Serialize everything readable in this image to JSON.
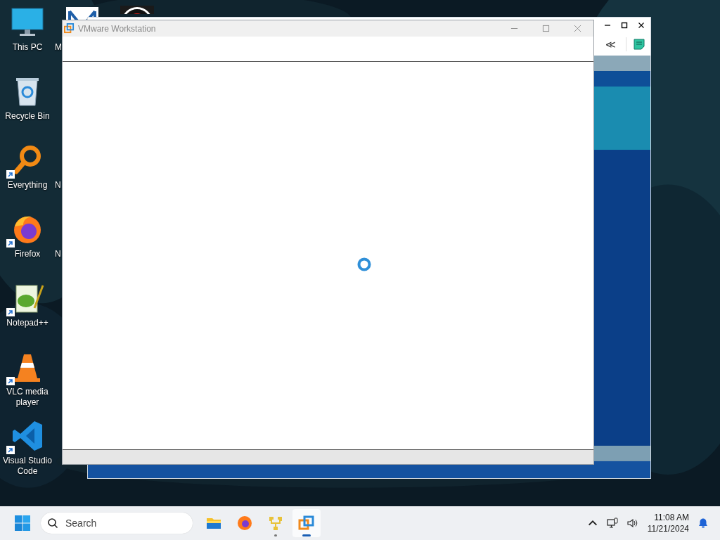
{
  "desktop_icons": [
    {
      "label": "This PC",
      "kind": "pc",
      "shortcut": false
    },
    {
      "label": "Recycle Bin",
      "kind": "bin",
      "shortcut": false
    },
    {
      "label": "Everything",
      "kind": "search",
      "shortcut": true
    },
    {
      "label": "Firefox",
      "kind": "firefox",
      "shortcut": true
    },
    {
      "label": "Notepad++",
      "kind": "notepad",
      "shortcut": true
    },
    {
      "label": "VLC media player",
      "kind": "vlc",
      "shortcut": true
    },
    {
      "label": "Visual Studio Code",
      "kind": "vscode",
      "shortcut": true
    }
  ],
  "desktop_icons_column_2": [
    {
      "label": "M",
      "kind": "mail"
    },
    {
      "kind": "blank"
    },
    {
      "label": "N",
      "kind": "blank"
    },
    {
      "label": "N",
      "kind": "blank"
    }
  ],
  "desktop_icons_column_3": [
    {
      "kind": "record"
    }
  ],
  "back_window": {
    "toolbar": [
      {
        "kind": "collapse",
        "text": "≪"
      },
      {
        "kind": "note"
      }
    ]
  },
  "window": {
    "title": "VMware Workstation",
    "loading": true
  },
  "taskbar": {
    "search": {
      "placeholder": "Search"
    },
    "apps": [
      {
        "kind": "explorer",
        "active": false,
        "running": false
      },
      {
        "kind": "firefox",
        "active": false,
        "running": false
      },
      {
        "kind": "tool",
        "active": false,
        "running": true
      },
      {
        "kind": "vmware",
        "active": true,
        "running": true
      }
    ],
    "tray": {
      "time": "11:08 AM",
      "date": "11/21/2024"
    }
  }
}
